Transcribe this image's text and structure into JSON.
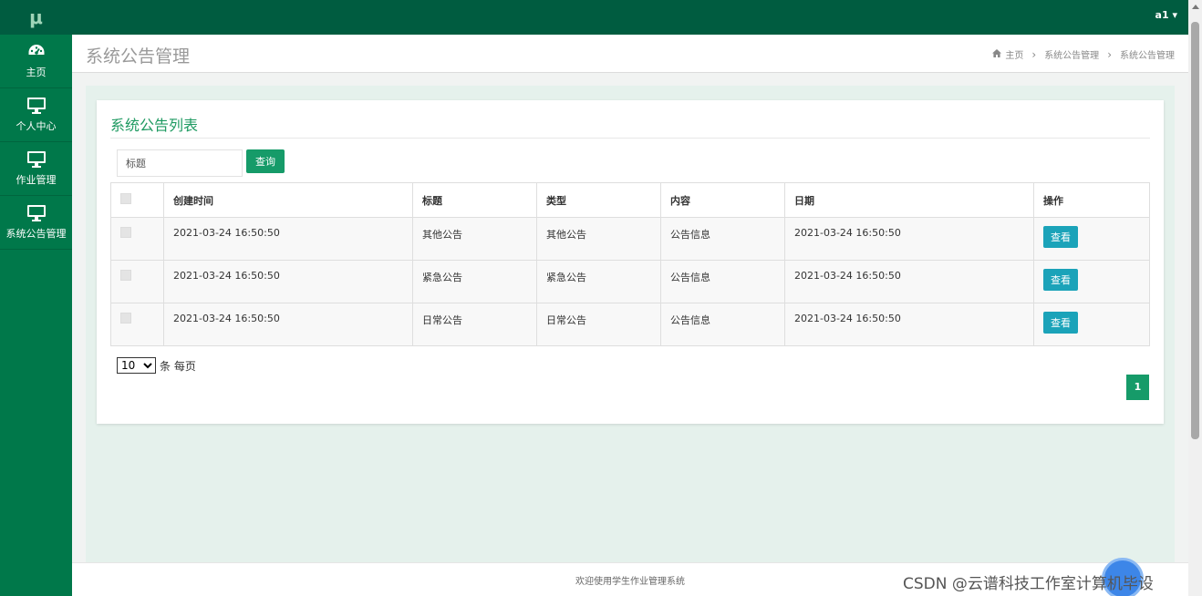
{
  "app": {
    "logo": "μ",
    "user": "a1",
    "user_caret": "▾"
  },
  "sidebar": {
    "items": [
      {
        "label": "主页",
        "icon": "dashboard-icon"
      },
      {
        "label": "个人中心",
        "icon": "monitor-icon"
      },
      {
        "label": "作业管理",
        "icon": "monitor-icon"
      },
      {
        "label": "系统公告管理",
        "icon": "monitor-icon"
      }
    ]
  },
  "header": {
    "title": "系统公告管理",
    "breadcrumb": [
      "主页",
      "系统公告管理",
      "系统公告管理"
    ],
    "breadcrumb_sep": "›"
  },
  "panel": {
    "title": "系统公告列表",
    "search": {
      "placeholder": "标题",
      "value": "",
      "button": "查询"
    }
  },
  "table": {
    "columns": [
      "创建时间",
      "标题",
      "类型",
      "内容",
      "日期",
      "操作"
    ],
    "rows": [
      {
        "created": "2021-03-24 16:50:50",
        "title": "其他公告",
        "type": "其他公告",
        "content": "公告信息",
        "date": "2021-03-24 16:50:50",
        "action": "查看"
      },
      {
        "created": "2021-03-24 16:50:50",
        "title": "紧急公告",
        "type": "紧急公告",
        "content": "公告信息",
        "date": "2021-03-24 16:50:50",
        "action": "查看"
      },
      {
        "created": "2021-03-24 16:50:50",
        "title": "日常公告",
        "type": "日常公告",
        "content": "公告信息",
        "date": "2021-03-24 16:50:50",
        "action": "查看"
      }
    ]
  },
  "pagination": {
    "page_size": "10",
    "page_size_options": [
      "10"
    ],
    "page_size_label": "条 每页",
    "current_page": "1"
  },
  "footer": {
    "text": "欢迎使用学生作业管理系统"
  },
  "watermark": "CSDN @云谱科技工作室计算机毕设",
  "colors": {
    "sidebar": "#00784a",
    "topbar": "#005c40",
    "accent": "#169b69",
    "view_button": "#1ba3b9",
    "content_bg": "#e5f1ec"
  }
}
